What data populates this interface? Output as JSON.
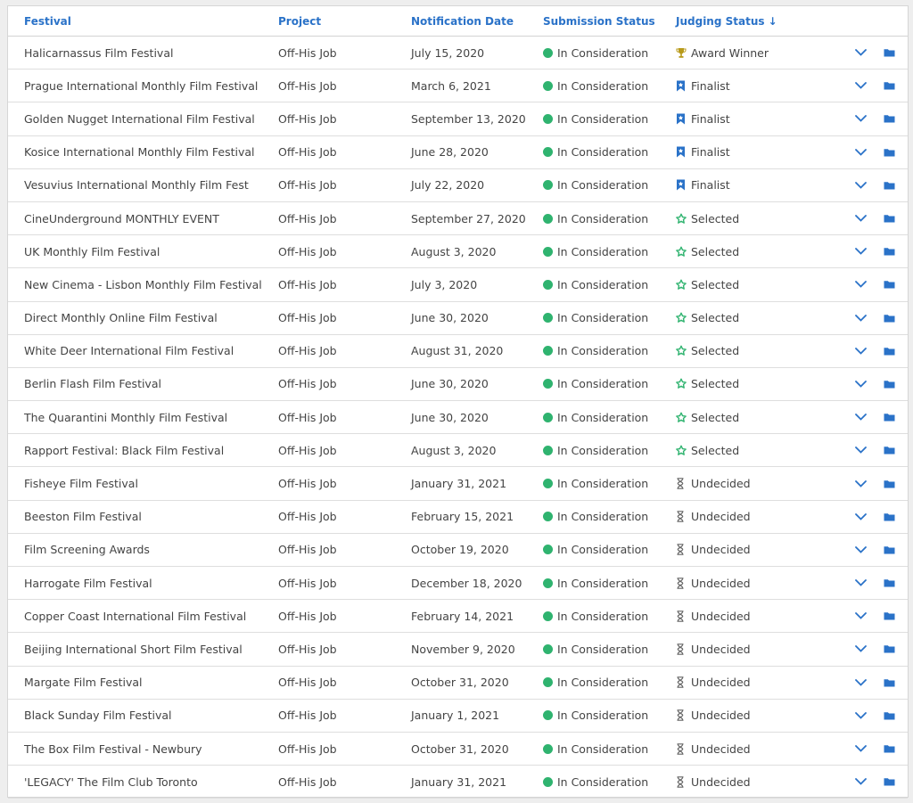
{
  "headers": {
    "festival": "Festival",
    "project": "Project",
    "notification_date": "Notification Date",
    "submission_status": "Submission Status",
    "judging_status": "Judging Status",
    "sort_indicator": "↓"
  },
  "colors": {
    "header_text": "#2a72c8",
    "status_dot": "#2fb36f",
    "award": "#b89a1a",
    "finalist": "#2a72c8",
    "selected": "#2fb36f",
    "undecided": "#666666",
    "action_icon": "#2a72c8"
  },
  "rows": [
    {
      "festival": "Halicarnassus Film Festival",
      "project": "Off-His Job",
      "date": "July 15, 2020",
      "submission": "In Consideration",
      "judging": "Award Winner",
      "judging_icon": "trophy-icon"
    },
    {
      "festival": "Prague International Monthly Film Festival",
      "project": "Off-His Job",
      "date": "March 6, 2021",
      "submission": "In Consideration",
      "judging": "Finalist",
      "judging_icon": "ribbon-icon"
    },
    {
      "festival": "Golden Nugget International Film Festival",
      "project": "Off-His Job",
      "date": "September 13, 2020",
      "submission": "In Consideration",
      "judging": "Finalist",
      "judging_icon": "ribbon-icon"
    },
    {
      "festival": "Kosice International Monthly Film Festival",
      "project": "Off-His Job",
      "date": "June 28, 2020",
      "submission": "In Consideration",
      "judging": "Finalist",
      "judging_icon": "ribbon-icon"
    },
    {
      "festival": "Vesuvius International Monthly Film Fest",
      "project": "Off-His Job",
      "date": "July 22, 2020",
      "submission": "In Consideration",
      "judging": "Finalist",
      "judging_icon": "ribbon-icon"
    },
    {
      "festival": "CineUnderground MONTHLY EVENT",
      "project": "Off-His Job",
      "date": "September 27, 2020",
      "submission": "In Consideration",
      "judging": "Selected",
      "judging_icon": "star-icon"
    },
    {
      "festival": "UK Monthly Film Festival",
      "project": "Off-His Job",
      "date": "August 3, 2020",
      "submission": "In Consideration",
      "judging": "Selected",
      "judging_icon": "star-icon"
    },
    {
      "festival": "New Cinema - Lisbon Monthly Film Festival",
      "project": "Off-His Job",
      "date": "July 3, 2020",
      "submission": "In Consideration",
      "judging": "Selected",
      "judging_icon": "star-icon"
    },
    {
      "festival": "Direct Monthly Online Film Festival",
      "project": "Off-His Job",
      "date": "June 30, 2020",
      "submission": "In Consideration",
      "judging": "Selected",
      "judging_icon": "star-icon"
    },
    {
      "festival": "White Deer International Film Festival",
      "project": "Off-His Job",
      "date": "August 31, 2020",
      "submission": "In Consideration",
      "judging": "Selected",
      "judging_icon": "star-icon"
    },
    {
      "festival": "Berlin Flash Film Festival",
      "project": "Off-His Job",
      "date": "June 30, 2020",
      "submission": "In Consideration",
      "judging": "Selected",
      "judging_icon": "star-icon"
    },
    {
      "festival": "The Quarantini Monthly Film Festival",
      "project": "Off-His Job",
      "date": "June 30, 2020",
      "submission": "In Consideration",
      "judging": "Selected",
      "judging_icon": "star-icon"
    },
    {
      "festival": "Rapport Festival: Black Film Festival",
      "project": "Off-His Job",
      "date": "August 3, 2020",
      "submission": "In Consideration",
      "judging": "Selected",
      "judging_icon": "star-icon"
    },
    {
      "festival": "Fisheye Film Festival",
      "project": "Off-His Job",
      "date": "January 31, 2021",
      "submission": "In Consideration",
      "judging": "Undecided",
      "judging_icon": "hourglass-icon"
    },
    {
      "festival": "Beeston Film Festival",
      "project": "Off-His Job",
      "date": "February 15, 2021",
      "submission": "In Consideration",
      "judging": "Undecided",
      "judging_icon": "hourglass-icon"
    },
    {
      "festival": "Film Screening Awards",
      "project": "Off-His Job",
      "date": "October 19, 2020",
      "submission": "In Consideration",
      "judging": "Undecided",
      "judging_icon": "hourglass-icon"
    },
    {
      "festival": "Harrogate Film Festival",
      "project": "Off-His Job",
      "date": "December 18, 2020",
      "submission": "In Consideration",
      "judging": "Undecided",
      "judging_icon": "hourglass-icon"
    },
    {
      "festival": "Copper Coast International Film Festival",
      "project": "Off-His Job",
      "date": "February 14, 2021",
      "submission": "In Consideration",
      "judging": "Undecided",
      "judging_icon": "hourglass-icon"
    },
    {
      "festival": "Beijing International Short Film Festival",
      "project": "Off-His Job",
      "date": "November 9, 2020",
      "submission": "In Consideration",
      "judging": "Undecided",
      "judging_icon": "hourglass-icon"
    },
    {
      "festival": "Margate Film Festival",
      "project": "Off-His Job",
      "date": "October 31, 2020",
      "submission": "In Consideration",
      "judging": "Undecided",
      "judging_icon": "hourglass-icon"
    },
    {
      "festival": "Black Sunday Film Festival",
      "project": "Off-His Job",
      "date": "January 1, 2021",
      "submission": "In Consideration",
      "judging": "Undecided",
      "judging_icon": "hourglass-icon"
    },
    {
      "festival": "The Box Film Festival - Newbury",
      "project": "Off-His Job",
      "date": "October 31, 2020",
      "submission": "In Consideration",
      "judging": "Undecided",
      "judging_icon": "hourglass-icon"
    },
    {
      "festival": "'LEGACY' The Film Club Toronto",
      "project": "Off-His Job",
      "date": "January 31, 2021",
      "submission": "In Consideration",
      "judging": "Undecided",
      "judging_icon": "hourglass-icon"
    }
  ]
}
